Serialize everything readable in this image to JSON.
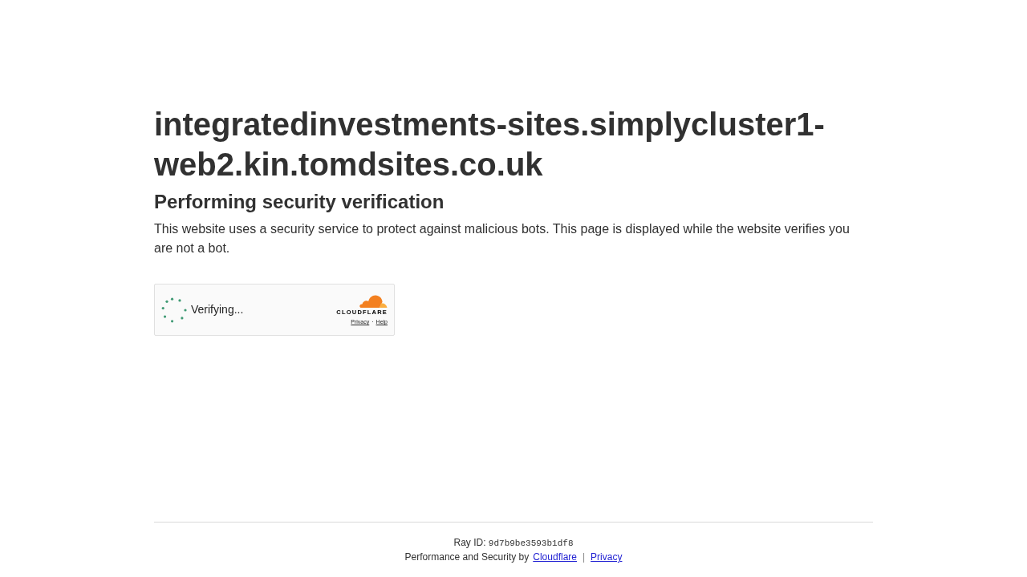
{
  "page": {
    "title": "integratedinvestments-sites.simplycluster1-web2.kin.tomdsites.co.uk",
    "heading": "Performing security verification",
    "description": "This website uses a security service to protect against malicious bots. This page is displayed while the website verifies you are not a bot."
  },
  "widget": {
    "status": "Verifying...",
    "brand": "CLOUDFLARE",
    "links": [
      {
        "label": "Privacy"
      },
      {
        "label": "Help"
      }
    ],
    "link_separator": "·"
  },
  "footer": {
    "ray_id_label": "Ray ID:",
    "ray_id": "9d7b9be3593b1df8",
    "credit": "Performance and Security by",
    "links": [
      {
        "label": "Cloudflare"
      },
      {
        "label": "Privacy"
      }
    ],
    "separator": "|"
  }
}
